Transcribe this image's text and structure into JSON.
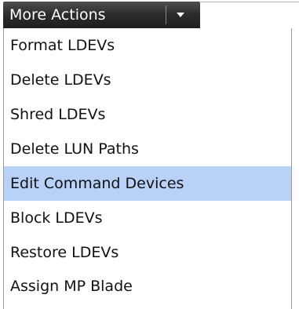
{
  "dropdown": {
    "label": "More Actions",
    "arrow_icon": "caret-down-icon"
  },
  "menu": {
    "items": [
      {
        "label": "Format LDEVs",
        "highlighted": false
      },
      {
        "label": "Delete LDEVs",
        "highlighted": false
      },
      {
        "label": "Shred LDEVs",
        "highlighted": false
      },
      {
        "label": "Delete LUN Paths",
        "highlighted": false
      },
      {
        "label": "Edit Command Devices",
        "highlighted": true
      },
      {
        "label": "Block LDEVs",
        "highlighted": false
      },
      {
        "label": "Restore LDEVs",
        "highlighted": false
      },
      {
        "label": "Assign MP Blade",
        "highlighted": false
      }
    ]
  },
  "colors": {
    "button_background": "#2b2b2b",
    "highlight": "#b7d1f7",
    "menu_border": "#9c9c9c"
  }
}
